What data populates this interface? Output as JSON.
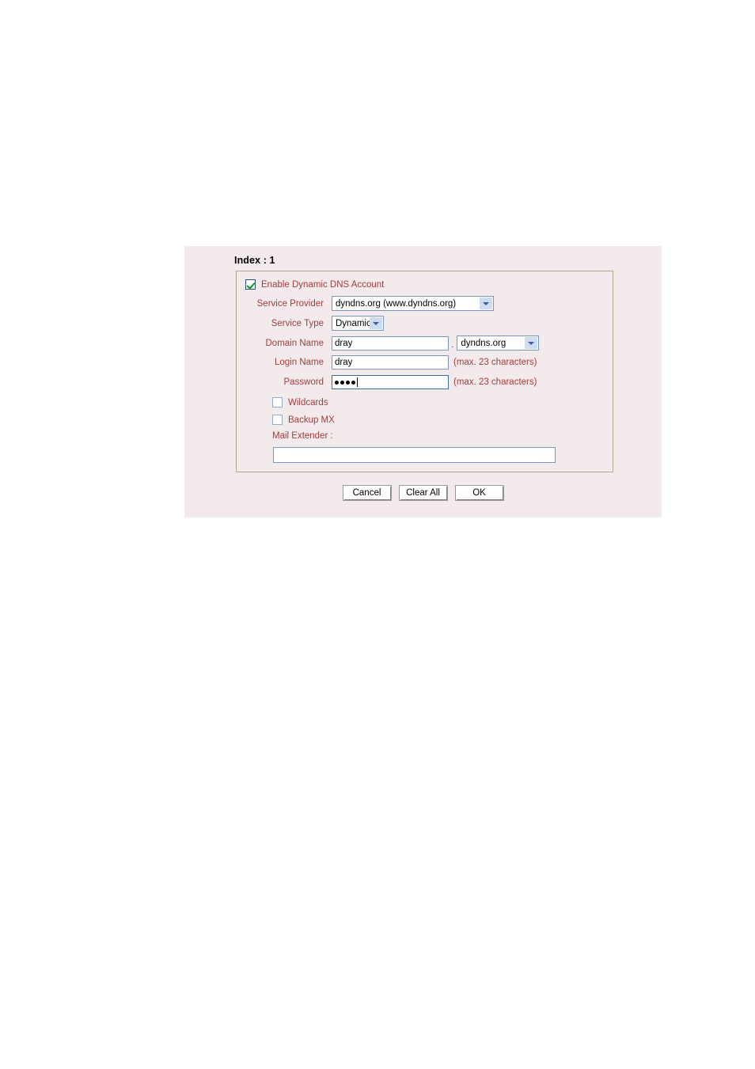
{
  "panel": {
    "index_heading": "Index : 1"
  },
  "form": {
    "enable_checkbox_label": "Enable Dynamic DNS Account",
    "enable_checkbox_checked": true,
    "service_provider": {
      "label": "Service Provider",
      "value": "dyndns.org (www.dyndns.org)"
    },
    "service_type": {
      "label": "Service Type",
      "value": "Dynamic"
    },
    "domain_name": {
      "label": "Domain Name",
      "value": "dray",
      "separator": ".",
      "suffix_value": "dyndns.org"
    },
    "login_name": {
      "label": "Login Name",
      "value": "dray",
      "hint": "(max. 23 characters)"
    },
    "password": {
      "label": "Password",
      "value": "••••",
      "masked_length": 4,
      "hint": "(max. 23 characters)"
    },
    "wildcards": {
      "label": "Wildcards",
      "checked": false
    },
    "backup_mx": {
      "label": "Backup MX",
      "checked": false
    },
    "mail_extender": {
      "label": "Mail Extender :",
      "value": ""
    }
  },
  "buttons": {
    "cancel": "Cancel",
    "clear_all": "Clear All",
    "ok": "OK"
  },
  "colors": {
    "panel_bg": "#f3eaec",
    "label_red": "#a33b3b",
    "box_border": "#a9a98c",
    "input_border": "#7b96b8",
    "check_green": "#149414",
    "arrow_blue": "#3b5f96"
  }
}
